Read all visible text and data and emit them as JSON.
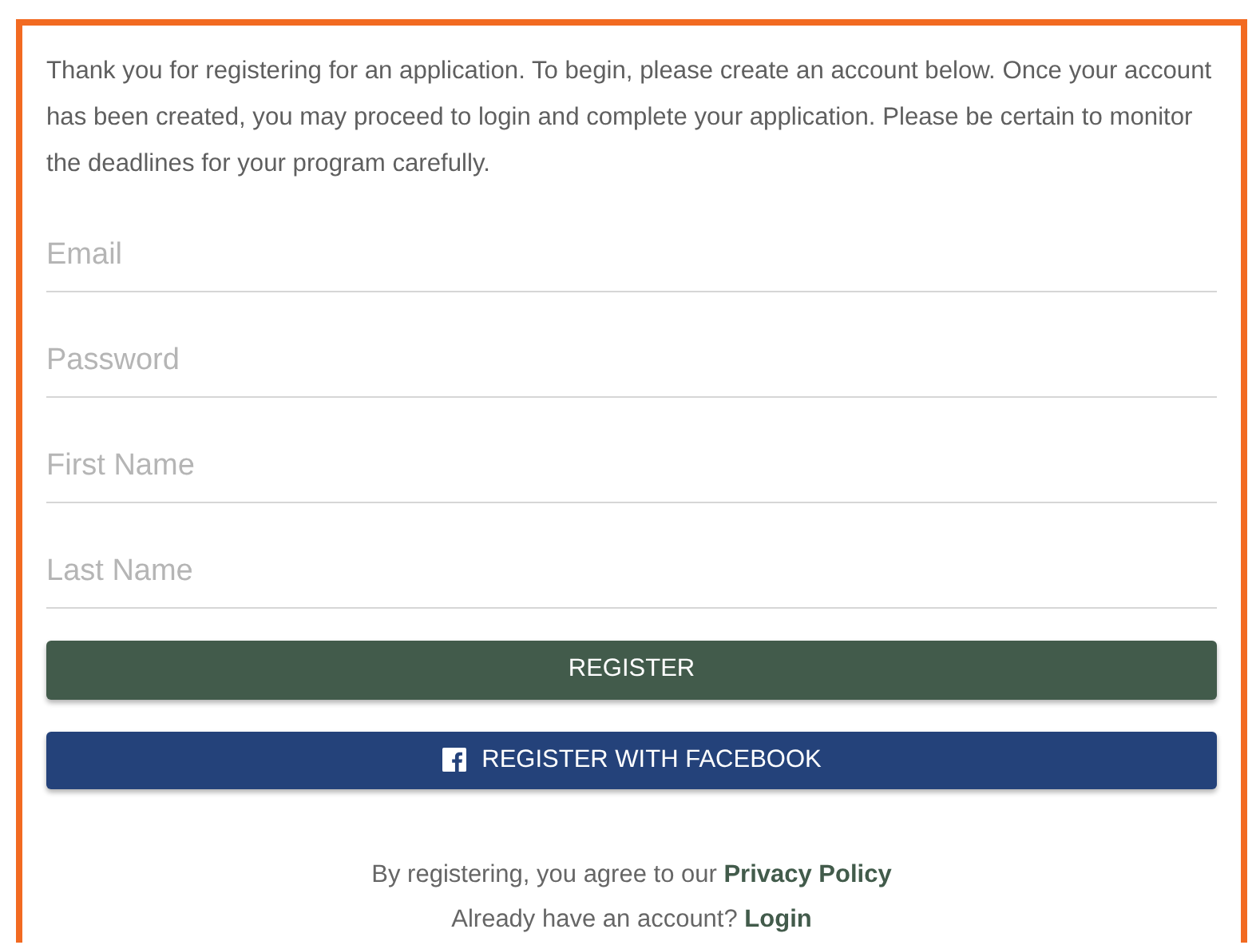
{
  "intro": "Thank you for registering for an application. To begin, please create an account below. Once your account has been created, you may proceed to login and complete your application. Please be certain to monitor the deadlines for your program carefully.",
  "fields": [
    {
      "placeholder": "Email"
    },
    {
      "placeholder": "Password"
    },
    {
      "placeholder": "First Name"
    },
    {
      "placeholder": "Last Name"
    }
  ],
  "buttons": [
    {
      "label": "REGISTER",
      "kind": "primary"
    },
    {
      "label": "REGISTER WITH FACEBOOK",
      "kind": "facebook"
    }
  ],
  "privacy": {
    "text": "By registering, you agree to our",
    "link": "Privacy Policy"
  },
  "login": {
    "text": "Already have an account?",
    "link": "Login"
  }
}
